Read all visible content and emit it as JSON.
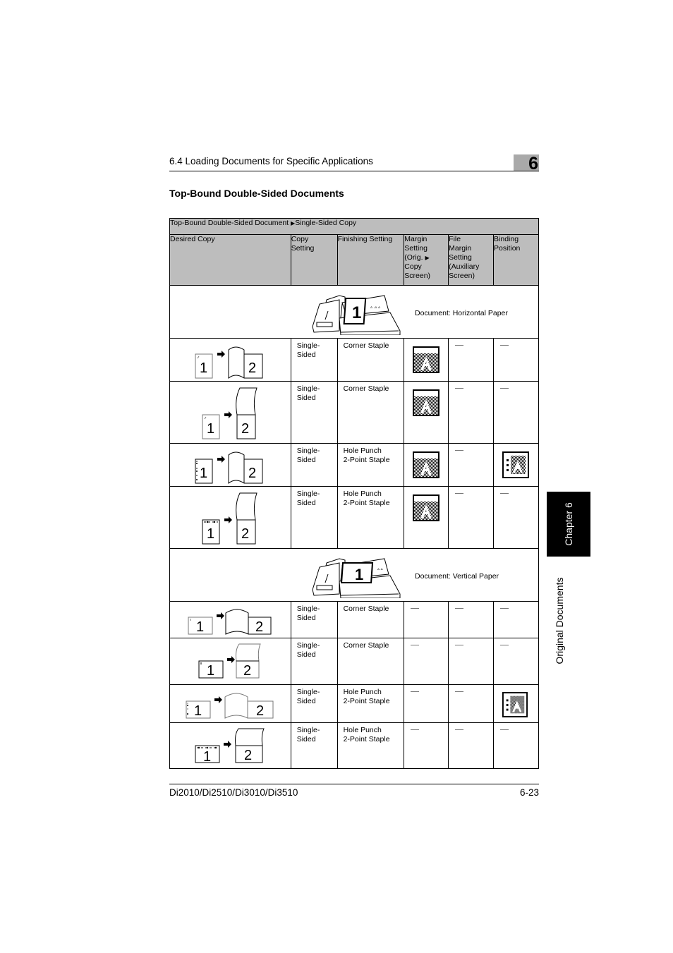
{
  "header": {
    "section": "6.4 Loading Documents for Specific Applications",
    "chapter_number": "6"
  },
  "section_title": "Top-Bound Double-Sided Documents",
  "table": {
    "caption_left": "Top-Bound Double-Sided Document",
    "caption_arrow": "▶",
    "caption_right": "Single-Sided Copy",
    "columns": [
      "Desired Copy",
      "Copy Setting",
      "Finishing Setting",
      "Margin Setting (Orig. ▶ Copy Screen)",
      "File Margin Setting (Auxiliary Screen)",
      "Binding Position"
    ],
    "groups": [
      {
        "label": "Document: Horizontal Paper",
        "scanner_page_number": "1",
        "rows": [
          {
            "desired_copy": "1 → 2 (side-by-side, corner staple)",
            "page1": "1",
            "page2": "2",
            "copy_setting": "Single-Sided",
            "finishing": "Corner Staple",
            "margin_setting": "top-margin-icon",
            "file_margin": "—",
            "binding_position": "—"
          },
          {
            "desired_copy": "1 → 2 (flip up, corner staple)",
            "page1": "1",
            "page2": "2",
            "copy_setting": "Single-Sided",
            "finishing": "Corner Staple",
            "margin_setting": "top-margin-icon",
            "file_margin": "—",
            "binding_position": "—"
          },
          {
            "desired_copy": "1 → 2 (side-by-side, left holes)",
            "page1": "1",
            "page2": "2",
            "copy_setting": "Single-Sided",
            "finishing": "Hole Punch\n2-Point Staple",
            "margin_setting": "top-margin-icon",
            "file_margin": "—",
            "binding_position": "left-binding-icon"
          },
          {
            "desired_copy": "1 → 2 (flip up, top holes)",
            "page1": "1",
            "page2": "2",
            "copy_setting": "Single-Sided",
            "finishing": "Hole Punch\n2-Point Staple",
            "margin_setting": "top-margin-icon",
            "file_margin": "—",
            "binding_position": "—"
          }
        ]
      },
      {
        "label": "Document: Vertical Paper",
        "scanner_page_number": "1",
        "rows": [
          {
            "desired_copy": "1 → 2 (side-by-side, corner staple)",
            "page1": "1",
            "page2": "2",
            "copy_setting": "Single-Sided",
            "finishing": "Corner Staple",
            "margin_setting": "—",
            "file_margin": "—",
            "binding_position": "—"
          },
          {
            "desired_copy": "1 → 2 (flip up, corner staple)",
            "page1": "1",
            "page2": "2",
            "copy_setting": "Single-Sided",
            "finishing": "Corner Staple",
            "margin_setting": "—",
            "file_margin": "—",
            "binding_position": "—"
          },
          {
            "desired_copy": "1 → 2 (side-by-side, left holes)",
            "page1": "1",
            "page2": "2",
            "copy_setting": "Single-Sided",
            "finishing": "Hole Punch\n2-Point Staple",
            "margin_setting": "—",
            "file_margin": "—",
            "binding_position": "left-binding-icon"
          },
          {
            "desired_copy": "1 → 2 (flip up, top holes)",
            "page1": "1",
            "page2": "2",
            "copy_setting": "Single-Sided",
            "finishing": "Hole Punch\n2-Point Staple",
            "margin_setting": "—",
            "file_margin": "—",
            "binding_position": "—"
          }
        ]
      }
    ]
  },
  "side_tab": {
    "chapter": "Chapter 6",
    "title": "Original Documents"
  },
  "footer": {
    "models": "Di2010/Di2510/Di3010/Di3510",
    "page": "6-23"
  }
}
